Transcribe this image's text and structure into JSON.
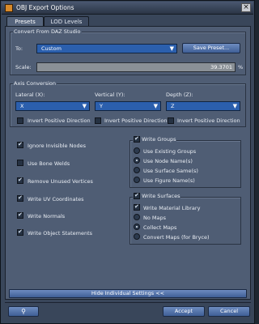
{
  "window": {
    "title": "OBJ Export Options",
    "close_glyph": "×"
  },
  "tabs": [
    {
      "label": "Presets"
    },
    {
      "label": "LOD Levels"
    }
  ],
  "convert": {
    "group_label": "Convert From DAZ Studio",
    "to_label": "To:",
    "to_value": "Custom",
    "save_preset_label": "Save Preset...",
    "scale_label": "Scale:",
    "scale_value": "39.3701",
    "scale_unit": "%"
  },
  "axis": {
    "group_label": "Axis Conversion",
    "lateral_label": "Lateral (X):",
    "vertical_label": "Vertical (Y):",
    "depth_label": "Depth (Z):",
    "lateral_value": "X",
    "vertical_value": "Y",
    "depth_value": "Z",
    "invert_label": "Invert Positive Direction"
  },
  "options": [
    {
      "label": "Ignore Invisible Nodes",
      "checked": true
    },
    {
      "label": "Use Bone Welds",
      "checked": false
    },
    {
      "label": "Remove Unused Vertices",
      "checked": true
    },
    {
      "label": "Write UV Coordinates",
      "checked": true
    },
    {
      "label": "Write Normals",
      "checked": true
    },
    {
      "label": "Write Object Statements",
      "checked": true
    }
  ],
  "groups": {
    "label": "Write Groups",
    "checked": true,
    "options": [
      {
        "label": "Use Existing Groups",
        "selected": false
      },
      {
        "label": "Use Node Name(s)",
        "selected": true
      },
      {
        "label": "Use Surface Same(s)",
        "selected": false
      },
      {
        "label": "Use Figure Name(s)",
        "selected": false
      }
    ]
  },
  "surfaces": {
    "label": "Write Surfaces",
    "checked": true,
    "options": [
      {
        "label": "Write Material Library",
        "type": "checkbox",
        "checked": true
      },
      {
        "label": "No Maps",
        "type": "radio",
        "selected": false
      },
      {
        "label": "Collect Maps",
        "type": "radio",
        "selected": true
      },
      {
        "label": "Convert Maps (for Bryce)",
        "type": "radio",
        "selected": false
      }
    ]
  },
  "hide_settings_label": "Hide Individual Settings <<",
  "footer": {
    "accept_label": "Accept",
    "cancel_label": "Cancel"
  },
  "colors": {
    "accent": "#2b5fad",
    "panel": "#4f5d74",
    "button": "#4f6fa6"
  }
}
